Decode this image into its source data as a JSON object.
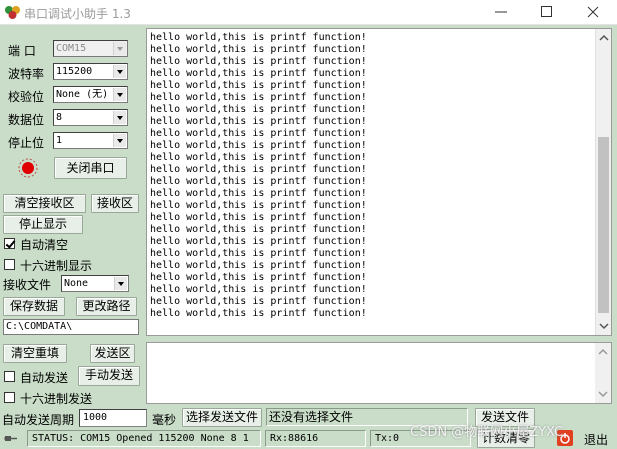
{
  "window": {
    "title": "串口调试小助手 1.3"
  },
  "serial": {
    "port_label": "端  口",
    "port_value": "COM15",
    "baud_label": "波特率",
    "baud_value": "115200",
    "parity_label": "校验位",
    "parity_value": "None (无)",
    "databits_label": "数据位",
    "databits_value": "8",
    "stopbits_label": "停止位",
    "stopbits_value": "1",
    "toggle_label": "关闭串口",
    "indicator_color": "#e00000"
  },
  "receive": {
    "clear_label": "清空接收区",
    "area_label": "接收区",
    "stop_label": "停止显示",
    "auto_clear_label": "自动清空",
    "auto_clear_checked": true,
    "hex_display_label": "十六进制显示",
    "hex_display_checked": false,
    "file_label": "接收文件",
    "file_value": "None",
    "save_label": "保存数据",
    "change_path_label": "更改路径",
    "path_value": "C:\\COMDATA\\",
    "lines": [
      "hello world,this is printf function!",
      "hello world,this is printf function!",
      "hello world,this is printf function!",
      "hello world,this is printf function!",
      "hello world,this is printf function!",
      "hello world,this is printf function!",
      "hello world,this is printf function!",
      "hello world,this is printf function!",
      "hello world,this is printf function!",
      "hello world,this is printf function!",
      "hello world,this is printf function!",
      "hello world,this is printf function!",
      "hello world,this is printf function!",
      "hello world,this is printf function!",
      "hello world,this is printf function!",
      "hello world,this is printf function!",
      "hello world,this is printf function!",
      "hello world,this is printf function!",
      "hello world,this is printf function!",
      "hello world,this is printf function!",
      "hello world,this is printf function!",
      "hello world,this is printf function!",
      "hello world,this is printf function!",
      "hello world,this is printf function!"
    ]
  },
  "send": {
    "clear_label": "清空重填",
    "area_label": "发送区",
    "auto_send_label": "自动发送",
    "auto_send_checked": false,
    "manual_send_label": "手动发送",
    "hex_send_label": "十六进制发送",
    "hex_send_checked": false,
    "period_label": "自动发送周期",
    "period_value": "1000",
    "ms_label": "毫秒",
    "select_file_label": "选择发送文件",
    "file_status": "还没有选择文件",
    "send_file_label": "发送文件"
  },
  "status": {
    "text": "STATUS: COM15 Opened 115200 None  8 1",
    "rx": "Rx:88616",
    "tx": "Tx:0",
    "reset_count_label": "计数清零",
    "exit_label": "退出"
  },
  "watermark": "CSDN @物联网小屋ZYXC"
}
